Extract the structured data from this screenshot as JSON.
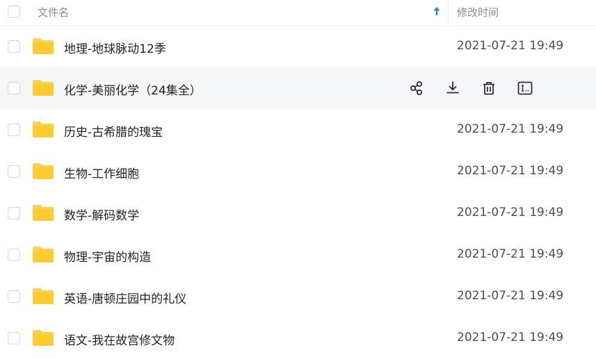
{
  "header": {
    "name_label": "文件名",
    "time_label": "修改时间",
    "sort_arrow_color": "#1e88e5"
  },
  "folder_color": "#ffd24a",
  "rows": [
    {
      "name": "地理-地球脉动12季",
      "time": "2021-07-21 19:49"
    },
    {
      "name": "化学-美丽化学（24集全）",
      "time": "",
      "hovered": true,
      "actions": [
        "share-icon",
        "download-icon",
        "delete-icon",
        "rename-icon"
      ]
    },
    {
      "name": "历史-古希腊的瑰宝",
      "time": "2021-07-21 19:49"
    },
    {
      "name": "生物-工作细胞",
      "time": "2021-07-21 19:49"
    },
    {
      "name": "数学-解码数学",
      "time": "2021-07-21 19:49"
    },
    {
      "name": "物理-宇宙的构造",
      "time": "2021-07-21 19:49"
    },
    {
      "name": "英语-唐顿庄园中的礼仪",
      "time": "2021-07-21 19:49"
    },
    {
      "name": "语文-我在故宫修文物",
      "time": "2021-07-21 19:49"
    }
  ]
}
